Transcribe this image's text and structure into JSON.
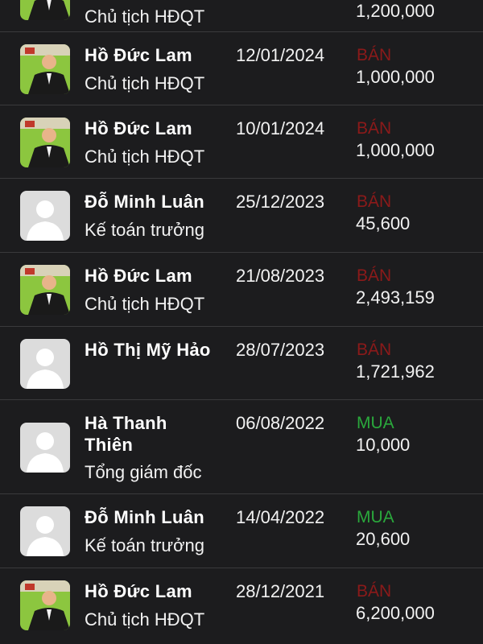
{
  "colors": {
    "background": "#1c1c1e",
    "sell": "#8b1a1a",
    "buy": "#2aa83c",
    "divider": "#3a3a3c"
  },
  "transactions": [
    {
      "name": "",
      "title": "Chủ tịch HĐQT",
      "date": "",
      "side": "",
      "quantity": "1,200,000",
      "avatar": "photo-avatar"
    },
    {
      "name": "Hồ Đức Lam",
      "title": "Chủ tịch HĐQT",
      "date": "12/01/2024",
      "side": "BÁN",
      "quantity": "1,000,000",
      "avatar": "photo-avatar"
    },
    {
      "name": "Hồ Đức Lam",
      "title": "Chủ tịch HĐQT",
      "date": "10/01/2024",
      "side": "BÁN",
      "quantity": "1,000,000",
      "avatar": "photo-avatar"
    },
    {
      "name": "Đỗ Minh Luân",
      "title": "Kế toán trưởng",
      "date": "25/12/2023",
      "side": "BÁN",
      "quantity": "45,600",
      "avatar": "placeholder-avatar"
    },
    {
      "name": "Hồ Đức Lam",
      "title": "Chủ tịch HĐQT",
      "date": "21/08/2023",
      "side": "BÁN",
      "quantity": "2,493,159",
      "avatar": "photo-avatar"
    },
    {
      "name": "Hồ Thị Mỹ Hảo",
      "title": "",
      "date": "28/07/2023",
      "side": "BÁN",
      "quantity": "1,721,962",
      "avatar": "placeholder-avatar"
    },
    {
      "name": "Hà Thanh Thiên",
      "title": "Tổng giám đốc",
      "date": "06/08/2022",
      "side": "MUA",
      "quantity": "10,000",
      "avatar": "placeholder-avatar"
    },
    {
      "name": "Đỗ Minh Luân",
      "title": "Kế toán trưởng",
      "date": "14/04/2022",
      "side": "MUA",
      "quantity": "20,600",
      "avatar": "placeholder-avatar"
    },
    {
      "name": "Hồ Đức Lam",
      "title": "Chủ tịch HĐQT",
      "date": "28/12/2021",
      "side": "BÁN",
      "quantity": "6,200,000",
      "avatar": "photo-avatar"
    }
  ]
}
